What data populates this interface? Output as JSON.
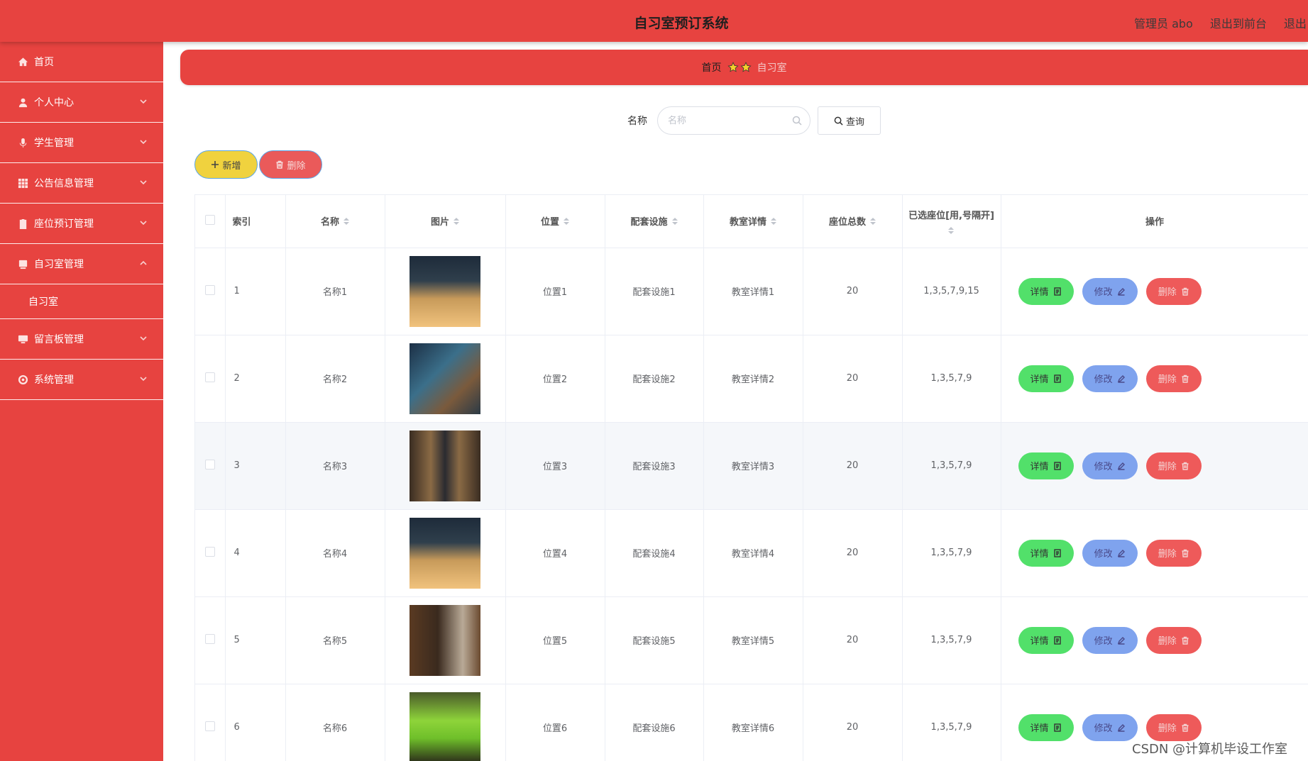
{
  "header": {
    "title": "自习室预订系统",
    "admin_label": "管理员 abo",
    "front_link": "退出到前台",
    "logout": "退出"
  },
  "sidebar": {
    "items": [
      {
        "label": "首页",
        "icon": "home-icon"
      },
      {
        "label": "个人中心",
        "icon": "user-icon"
      },
      {
        "label": "学生管理",
        "icon": "microphone-icon"
      },
      {
        "label": "公告信息管理",
        "icon": "grid-icon"
      },
      {
        "label": "座位预订管理",
        "icon": "clipboard-icon"
      },
      {
        "label": "自习室管理",
        "icon": "book-icon",
        "expanded": true
      },
      {
        "label": "留言板管理",
        "icon": "monitor-icon"
      },
      {
        "label": "系统管理",
        "icon": "settings-icon"
      }
    ],
    "subitems": {
      "study_room": "自习室"
    }
  },
  "breadcrumb": {
    "home": "首页",
    "current": "自习室"
  },
  "search": {
    "label": "名称",
    "placeholder": "名称",
    "button": "查询"
  },
  "actions": {
    "add": "新增",
    "delete": "删除"
  },
  "table": {
    "headers": {
      "index": "索引",
      "name": "名称",
      "image": "图片",
      "location": "位置",
      "facilities": "配套设施",
      "details": "教室详情",
      "seat_total": "座位总数",
      "selected_seats": "已选座位[用,号隔开]",
      "operations": "操作"
    },
    "buttons": {
      "detail": "详情",
      "edit": "修改",
      "delete": "删除"
    },
    "rows": [
      {
        "index": "1",
        "name": "名称1",
        "location": "位置1",
        "facilities": "配套设施1",
        "details": "教室详情1",
        "seats": "20",
        "selected": "1,3,5,7,9,15",
        "image": "study-room-photo-1"
      },
      {
        "index": "2",
        "name": "名称2",
        "location": "位置2",
        "facilities": "配套设施2",
        "details": "教室详情2",
        "seats": "20",
        "selected": "1,3,5,7,9",
        "image": "study-room-photo-2"
      },
      {
        "index": "3",
        "name": "名称3",
        "location": "位置3",
        "facilities": "配套设施3",
        "details": "教室详情3",
        "seats": "20",
        "selected": "1,3,5,7,9",
        "image": "study-room-photo-3"
      },
      {
        "index": "4",
        "name": "名称4",
        "location": "位置4",
        "facilities": "配套设施4",
        "details": "教室详情4",
        "seats": "20",
        "selected": "1,3,5,7,9",
        "image": "study-room-photo-4"
      },
      {
        "index": "5",
        "name": "名称5",
        "location": "位置5",
        "facilities": "配套设施5",
        "details": "教室详情5",
        "seats": "20",
        "selected": "1,3,5,7,9",
        "image": "study-room-photo-5"
      },
      {
        "index": "6",
        "name": "名称6",
        "location": "位置6",
        "facilities": "配套设施6",
        "details": "教室详情6",
        "seats": "20",
        "selected": "1,3,5,7,9",
        "image": "study-room-photo-6"
      }
    ]
  },
  "watermark": "CSDN @计算机毕设工作室",
  "colors": {
    "primary": "#e74340",
    "add_button": "#f0d23e",
    "detail_button": "#52e06a",
    "edit_button": "#7fa3ee",
    "delete_button": "#ee5a5a"
  }
}
